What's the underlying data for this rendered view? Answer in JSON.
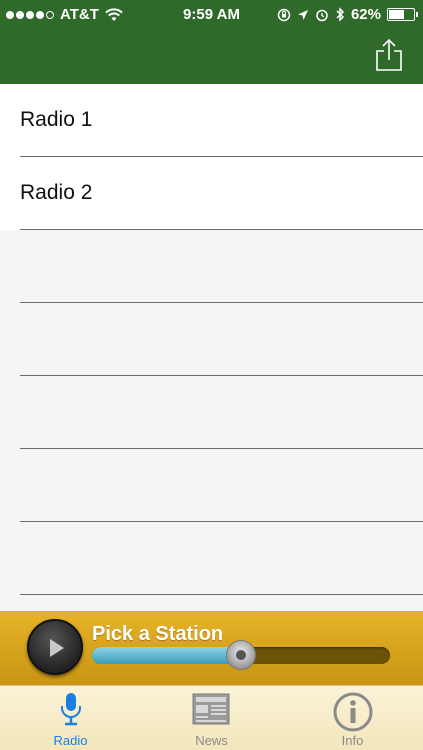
{
  "status_bar": {
    "carrier": "AT&T",
    "time": "9:59 AM",
    "battery": "62%",
    "battery_level": 0.62,
    "signal_bars": 4
  },
  "header": {
    "share_icon": "share-icon"
  },
  "list": {
    "items": [
      {
        "label": "Radio 1"
      },
      {
        "label": "Radio 2"
      },
      {
        "label": ""
      },
      {
        "label": ""
      },
      {
        "label": ""
      },
      {
        "label": ""
      },
      {
        "label": ""
      },
      {
        "label": ""
      }
    ]
  },
  "player": {
    "title": "Pick a Station",
    "progress": 0.5,
    "play_icon": "play-icon"
  },
  "tabs": [
    {
      "label": "Radio",
      "icon": "microphone-icon",
      "active": true
    },
    {
      "label": "News",
      "icon": "newspaper-icon",
      "active": false
    },
    {
      "label": "Info",
      "icon": "info-icon",
      "active": false
    }
  ],
  "colors": {
    "header": "#2f6a2a",
    "active_tab": "#1a7fe0",
    "player": "#e6b328"
  }
}
